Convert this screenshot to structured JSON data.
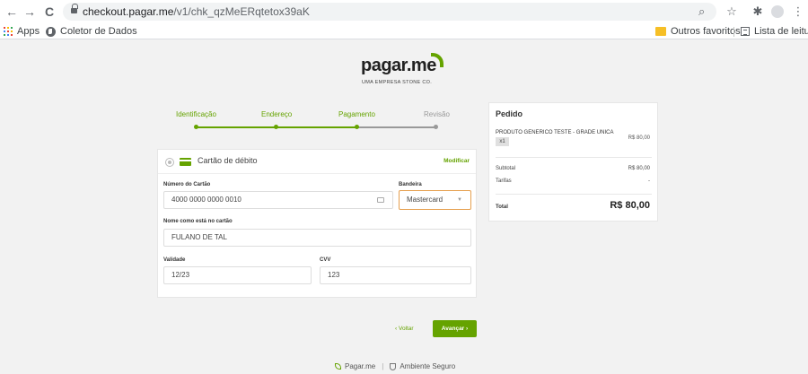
{
  "browser": {
    "url_domain": "checkout.pagar.me",
    "url_path": "/v1/chk_qzMeERqtetox39aK",
    "back_icon": "←",
    "forward_icon": "→",
    "reload_icon": "C",
    "zoom_icon": "⌕",
    "star_icon": "☆",
    "extensions_icon": "✱",
    "menu_icon": "⋮",
    "bookmarks": {
      "apps": "Apps",
      "coletor": "Coletor de Dados",
      "outros": "Outros favoritos",
      "lista": "Lista de leitura"
    },
    "apps_colors": [
      "#ea4335",
      "#fbbc04",
      "#34a853",
      "#4285f4"
    ]
  },
  "brand": {
    "logo_main": "pagar",
    "logo_dot": ".me",
    "tagline": "UMA EMPRESA STONE CO.",
    "accent": "#65a300"
  },
  "stepper": {
    "steps": [
      {
        "label": "Identificação",
        "state": "done"
      },
      {
        "label": "Endereço",
        "state": "done"
      },
      {
        "label": "Pagamento",
        "state": "active"
      },
      {
        "label": "Revisão",
        "state": "pending"
      }
    ],
    "active_color": "#65a300",
    "pending_color": "#999999"
  },
  "payment": {
    "method_label": "Cartão de débito",
    "modify_label": "Modificar",
    "card_number_label": "Número do Cartão",
    "card_number_value": "4000 0000 0000 0010",
    "brand_label": "Bandeira",
    "brand_value": "Mastercard",
    "brand_caret": "▼",
    "name_label": "Nome como está no cartão",
    "name_value": "FULANO DE TAL",
    "validity_label": "Validade",
    "validity_value": "12/23",
    "cvv_label": "CVV",
    "cvv_value": "123"
  },
  "actions": {
    "back_label": "‹ Voltar",
    "advance_label": "Avançar ›"
  },
  "order": {
    "title": "Pedido",
    "product_name": "PRODUTO GENERICO TESTE - GRADE UNICA",
    "product_price": "R$ 80,00",
    "quantity": "x1",
    "subtotal_label": "Subtotal",
    "subtotal_value": "R$ 80,00",
    "fees_label": "Tarifas",
    "fees_value": "-",
    "total_label": "Total",
    "total_value": "R$ 80,00"
  },
  "footer": {
    "brand": "Pagar.me",
    "separator": "|",
    "secure": "Ambiente Seguro"
  }
}
